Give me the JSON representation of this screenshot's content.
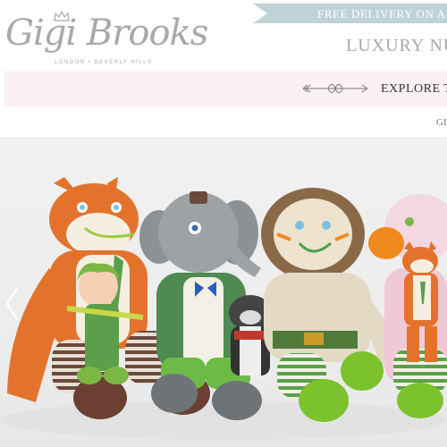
{
  "brand": {
    "name": "Gigi Brooks",
    "subtitle": "LONDON • BEVERLY HILLS",
    "crown_icon": "crown-icon"
  },
  "header": {
    "delivery_banner": "FREE DELIVERY ON ALL",
    "tagline": "LUXURY NU"
  },
  "explore": {
    "label": "EXPLORE T",
    "ornament_icon": "arrow-ornament-icon"
  },
  "nav": {
    "partial_link": "GI"
  },
  "hero": {
    "image": "knitted-toy-animals-photo",
    "prev_icon": "chevron-left-icon"
  },
  "colors": {
    "banner": "#bed3d6",
    "explore_bg": "#fbf1f2",
    "logo_gray": "#a9a9a9"
  }
}
